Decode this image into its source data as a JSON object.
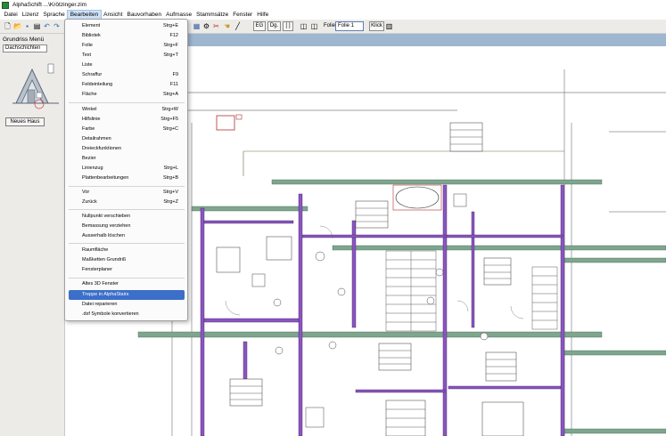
{
  "window": {
    "title": "AlphaSchift ...\\Krötzinger.zim"
  },
  "menubar": [
    "Datei",
    "Lizenz",
    "Sprache",
    "Bearbeiten",
    "Ansicht",
    "Bauvorhaben",
    "Aufmasse",
    "Stammsätze",
    "Fenster",
    "Hilfe"
  ],
  "toolbar": {
    "floor_btn": "EG",
    "dg_btn": "Dg.",
    "bracket_btn": "[ ]",
    "foil_label": "Folie:",
    "foil_value": "Folie 1",
    "klick_btn": "Klick"
  },
  "sidepanel": {
    "title": "Grundriss Menü",
    "layer_select": "Dachschichten",
    "new_house_btn": "Neues Haus"
  },
  "dropdown": {
    "items": [
      {
        "label": "Element",
        "shortcut": "Strg+E"
      },
      {
        "label": "Bibliotek",
        "shortcut": "F12"
      },
      {
        "label": "Folie",
        "shortcut": "Strg+F"
      },
      {
        "label": "Text",
        "shortcut": "Strg+T"
      },
      {
        "label": "Liste",
        "shortcut": ""
      },
      {
        "label": "Schraffur",
        "shortcut": "F9"
      },
      {
        "label": "Feldeinteilung",
        "shortcut": "F11"
      },
      {
        "label": "Fläche",
        "shortcut": "Strg+A"
      },
      {
        "label": "Winkel",
        "shortcut": "Strg+W"
      },
      {
        "label": "Hilfslinie",
        "shortcut": "Strg+F5"
      },
      {
        "label": "Farbe",
        "shortcut": "Strg+C"
      },
      {
        "label": "Detailrahmen",
        "shortcut": ""
      },
      {
        "label": "Dreieckfunktionen",
        "shortcut": ""
      },
      {
        "label": "Bezier",
        "shortcut": ""
      },
      {
        "label": "Linienzug",
        "shortcut": "Strg+L"
      },
      {
        "label": "Plattenbearbeitungen",
        "shortcut": "Strg+B"
      },
      {
        "label": "Vor",
        "shortcut": "Strg+V"
      },
      {
        "label": "Zurück",
        "shortcut": "Strg+Z"
      },
      {
        "label": "Nullpunkt verschieben",
        "shortcut": ""
      },
      {
        "label": "Bemassung verziehen",
        "shortcut": ""
      },
      {
        "label": "Ausserhalb löschen",
        "shortcut": ""
      },
      {
        "label": "Raumfläche",
        "shortcut": ""
      },
      {
        "label": "Maßketten Grundriß",
        "shortcut": ""
      },
      {
        "label": "Fensterplaner",
        "shortcut": ""
      },
      {
        "label": "Altes 3D Fenster",
        "shortcut": ""
      },
      {
        "label": "Treppe in AlphaStairs",
        "shortcut": ""
      },
      {
        "label": "Datei reparieren",
        "shortcut": ""
      },
      {
        "label": ".dxf Symbole konvertieren",
        "shortcut": ""
      }
    ],
    "selected_index": 25
  },
  "colors": {
    "selection": "#3b6fc9",
    "beam": "#7fa58f",
    "wall": "#5b2a8a",
    "canvas_band": "#9eb6cf"
  }
}
